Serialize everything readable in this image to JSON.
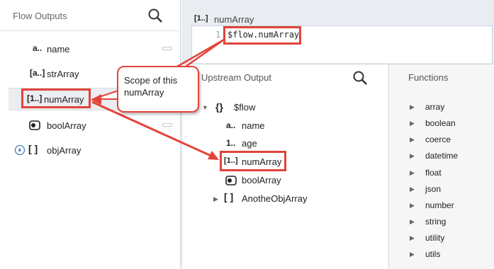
{
  "left_panel": {
    "title": "Flow Outputs",
    "items": [
      {
        "icon": "a..",
        "label": "name",
        "linked": true
      },
      {
        "icon": "[a..]",
        "label": "strArray",
        "linked": false
      },
      {
        "icon": "[1..]",
        "label": "numArray",
        "linked": false,
        "selected": true
      },
      {
        "icon": "boolean",
        "label": "boolArray",
        "linked": true
      },
      {
        "icon": "[ ]",
        "label": "objArray",
        "linked": false,
        "expandable": true
      }
    ]
  },
  "editor": {
    "type_icon": "[1..]",
    "variable": "numArray",
    "line_number": "1",
    "expression": "$flow.numArray"
  },
  "upstream": {
    "title": "Upstream Output",
    "root_icon": "{}",
    "root": "$flow",
    "items": [
      {
        "icon": "a..",
        "label": "name"
      },
      {
        "icon": "1..",
        "label": "age"
      },
      {
        "icon": "[1..]",
        "label": "numArray"
      },
      {
        "icon": "boolean",
        "label": "boolArray"
      },
      {
        "icon": "[ ]",
        "label": "AnotheObjArray"
      }
    ]
  },
  "functions": {
    "title": "Functions",
    "items": [
      "array",
      "boolean",
      "coerce",
      "datetime",
      "float",
      "json",
      "number",
      "string",
      "utility",
      "utils"
    ]
  },
  "callout": {
    "text": "Scope of this numArray"
  },
  "colors": {
    "highlight": "#e2443b",
    "selected_bg": "#ebedf0",
    "panel_bg": "#e9edf2",
    "functions_bg": "#f6f6f6"
  }
}
